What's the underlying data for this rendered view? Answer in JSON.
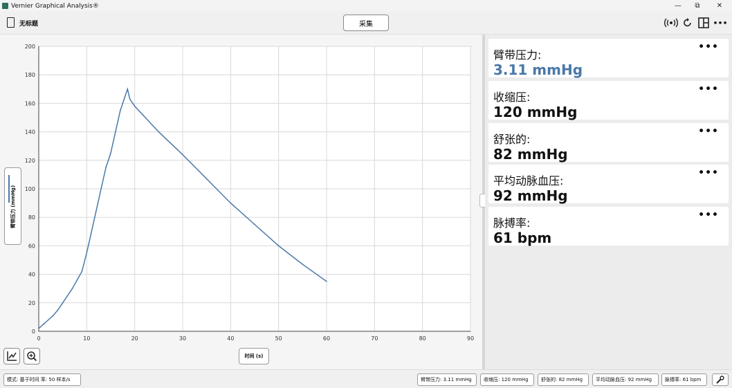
{
  "window": {
    "title": "Vernier Graphical Analysis®",
    "min": "—",
    "restore": "⧉",
    "close": "✕"
  },
  "toolbar": {
    "doc_title": "无标题",
    "collect_label": "采集",
    "more": "•••"
  },
  "chart_data": {
    "type": "line",
    "xlabel": "时间 (s)",
    "ylabel": "臂带压力 (mmHg)",
    "xlim": [
      0,
      90
    ],
    "ylim": [
      0,
      200
    ],
    "xticks": [
      0,
      10,
      20,
      30,
      40,
      50,
      60,
      70,
      80,
      90
    ],
    "yticks": [
      0,
      20,
      40,
      60,
      80,
      100,
      120,
      140,
      160,
      180,
      200
    ],
    "grid": true,
    "series": [
      {
        "color": "#4a78a8",
        "x": [
          0,
          1,
          2,
          3,
          4,
          5,
          6,
          7,
          8,
          9,
          10,
          11,
          12,
          13,
          14,
          15,
          16,
          17,
          18,
          18.5,
          19,
          20,
          25,
          30,
          35,
          40,
          45,
          50,
          55,
          60
        ],
        "y": [
          2,
          5,
          8,
          11,
          15,
          20,
          25,
          30,
          36,
          42,
          55,
          70,
          85,
          100,
          115,
          125,
          140,
          155,
          165,
          170,
          163,
          158,
          140,
          124,
          107,
          90,
          75,
          60,
          47,
          35
        ]
      }
    ]
  },
  "meters": [
    {
      "label": "臂带压力:",
      "value": "3.11 mmHg",
      "color": "#4a78a8"
    },
    {
      "label": "收缩压:",
      "value": "120 mmHg",
      "color": "#111111"
    },
    {
      "label": "舒张的:",
      "value": "82 mmHg",
      "color": "#111111"
    },
    {
      "label": "平均动脉血压:",
      "value": "92 mmHg",
      "color": "#111111"
    },
    {
      "label": "脉搏率:",
      "value": "61 bpm",
      "color": "#111111"
    }
  ],
  "status": {
    "mode": "模式: 基于时间    率: 50 样本/s",
    "chips": [
      "臂带压力: 3.11 mmHg",
      "收缩压: 120 mmHg",
      "舒张的: 82 mmHg",
      "平均动脉血压: 92 mmHg",
      "脉搏率: 61 bpm"
    ]
  }
}
